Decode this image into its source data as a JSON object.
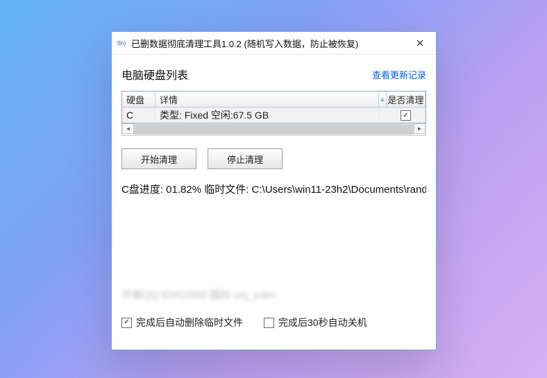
{
  "window": {
    "title": "已删数据彻底清理工具1.0.2 (随机写入数据，防止被恢复)"
  },
  "header": {
    "title": "电脑硬盘列表",
    "updates_link": "查看更新记录"
  },
  "grid": {
    "columns": {
      "disk": "硬盘",
      "detail": "详情",
      "clean": "是否清理"
    },
    "rows": [
      {
        "disk": "C",
        "detail": "类型: Fixed 空闲:67.5 GB",
        "clean_checked": true
      }
    ]
  },
  "buttons": {
    "start": "开始清理",
    "stop": "停止清理"
  },
  "status": "C盘进度: 01.82% 临时文件: C:\\Users\\win11-23h2\\Documents\\rand",
  "blurred_info": "作者QQ:83411993 国际 unj_yukn",
  "options": {
    "auto_delete_temp": {
      "label": "完成后自动删除临时文件",
      "checked": true
    },
    "auto_shutdown": {
      "label": "完成后30秒自动关机",
      "checked": false
    }
  }
}
